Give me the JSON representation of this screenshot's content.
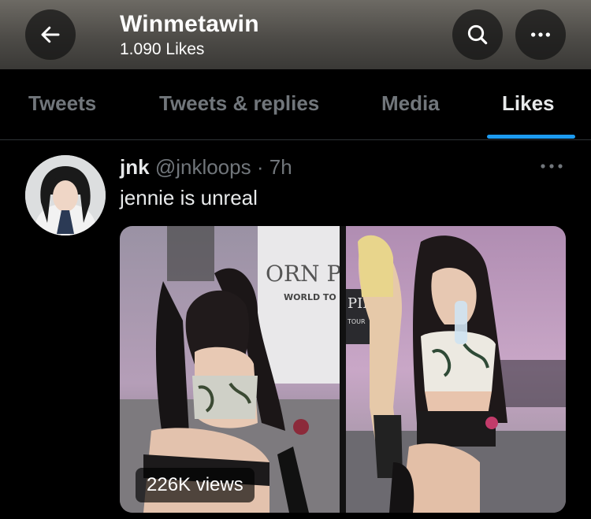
{
  "header": {
    "title": "Winmetawin",
    "subtitle": "1.090 Likes",
    "back_icon": "back-arrow-icon",
    "search_icon": "search-icon",
    "more_icon": "more-horizontal-icon"
  },
  "tabs": [
    {
      "label": "Tweets",
      "active": false
    },
    {
      "label": "Tweets & replies",
      "active": false
    },
    {
      "label": "Media",
      "active": false
    },
    {
      "label": "Likes",
      "active": true
    }
  ],
  "tweet": {
    "author_name": "jnk",
    "handle": "@jnkloops",
    "separator": "·",
    "time": "7h",
    "text": "jennie is unreal",
    "media": {
      "views": "226K views",
      "left_sign_text": "ORN P",
      "left_sign_sub": "WORLD TO",
      "right_sign_text": "PIN",
      "right_sign_sub": "TOUR"
    }
  },
  "colors": {
    "accent": "#1d9bf0",
    "text_primary": "#e7e9ea",
    "text_secondary": "#71767b",
    "background": "#000000"
  }
}
